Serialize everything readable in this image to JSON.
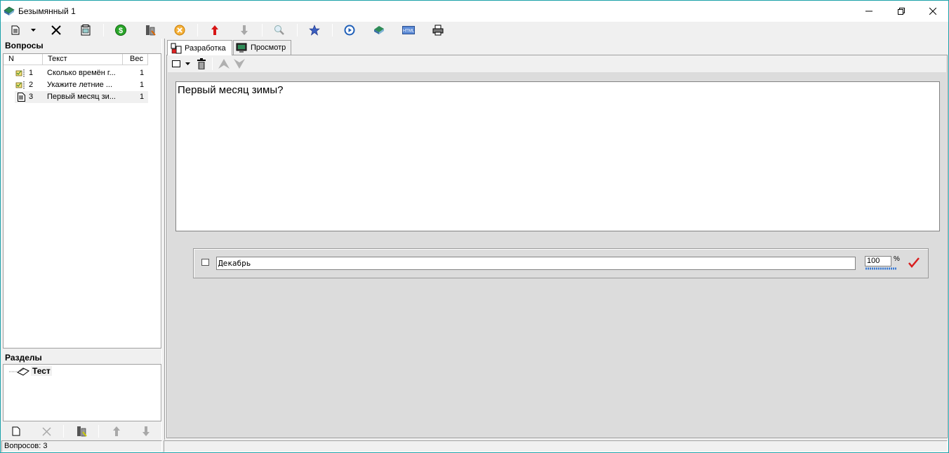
{
  "window": {
    "title": "Безымянный 1"
  },
  "toolbar": {
    "buttons": [
      "new-doc-icon",
      "dropdown-arrow-icon",
      "delete-icon",
      "properties-icon",
      "money-icon",
      "settings-icon",
      "cancel-icon",
      "move-up-icon",
      "move-down-icon",
      "search-icon",
      "star-icon",
      "play-icon",
      "export-icon",
      "html-icon",
      "print-icon"
    ]
  },
  "questions_panel": {
    "header": "Вопросы",
    "columns": [
      "N",
      "Текст",
      "Вес"
    ],
    "rows": [
      {
        "n": "1",
        "text": "Сколько времён г...",
        "weight": "1"
      },
      {
        "n": "2",
        "text": "Укажите летние ...",
        "weight": "1"
      },
      {
        "n": "3",
        "text": "Первый месяц зи...",
        "weight": "1"
      }
    ]
  },
  "sections_panel": {
    "header": "Разделы",
    "items": [
      {
        "label": "Тест"
      }
    ]
  },
  "tabs": [
    {
      "label": "Разработка"
    },
    {
      "label": "Просмотр"
    }
  ],
  "editor": {
    "question_text": "Первый месяц зимы?",
    "answers": [
      {
        "text": "Декабрь",
        "percent": "100",
        "percent_sign": "%",
        "correct": true
      }
    ]
  },
  "status": {
    "left": "Вопросов: 3",
    "right": ""
  },
  "colors": {
    "accent": "#1ba1a9",
    "content_bg": "#dcdcdc",
    "check": "#d81e1e"
  }
}
